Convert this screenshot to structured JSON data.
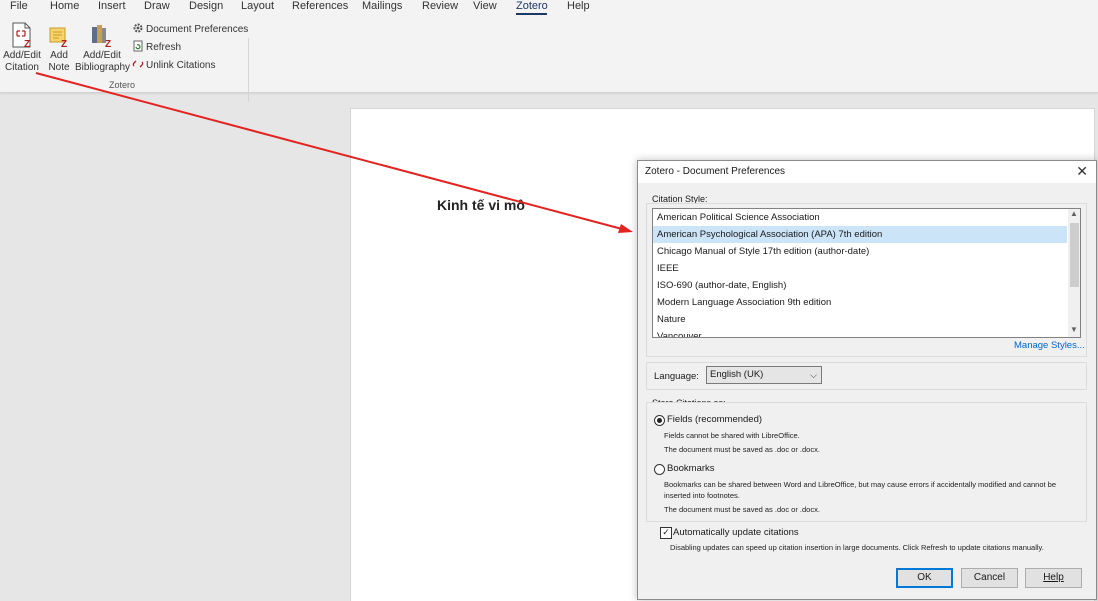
{
  "menubar": {
    "items": [
      "File",
      "Home",
      "Insert",
      "Draw",
      "Design",
      "Layout",
      "References",
      "Mailings",
      "Review",
      "View",
      "Zotero",
      "Help"
    ],
    "active": "Zotero"
  },
  "ribbon": {
    "add_edit_citation": {
      "line1": "Add/Edit",
      "line2": "Citation",
      "icon": "add-citation-icon"
    },
    "add_note": {
      "line1": "Add",
      "line2": "Note",
      "icon": "add-note-icon"
    },
    "add_edit_bibliography": {
      "line1": "Add/Edit",
      "line2": "Bibliography",
      "icon": "bibliography-icon"
    },
    "document_preferences": {
      "label": "Document Preferences",
      "icon": "gear-icon"
    },
    "refresh": {
      "label": "Refresh",
      "icon": "refresh-icon"
    },
    "unlink_citations": {
      "label": "Unlink Citations",
      "icon": "unlink-icon"
    },
    "group_label": "Zotero"
  },
  "document": {
    "heading": "Kinh tế vi mô"
  },
  "annotation": {
    "arrow_color": "#e3231f"
  },
  "dialog": {
    "title": "Zotero - Document Preferences",
    "citation_style_label": "Citation Style:",
    "styles": [
      "American Political Science Association",
      "American Psychological Association (APA) 7th edition",
      "Chicago Manual of Style 17th edition (author-date)",
      "IEEE",
      "ISO-690 (author-date, English)",
      "Modern Language Association 9th edition",
      "Nature",
      "Vancouver"
    ],
    "selected_style": "American Psychological Association (APA) 7th edition",
    "manage_styles": "Manage Styles...",
    "language_label": "Language:",
    "language_value": "English (UK)",
    "store_label": "Store Citations as:",
    "fields_option": "Fields (recommended)",
    "fields_note1": "Fields cannot be shared with LibreOffice.",
    "fields_note2": "The document must be saved as .doc or .docx.",
    "bookmarks_option": "Bookmarks",
    "bookmarks_note1": "Bookmarks can be shared between Word and LibreOffice, but may cause errors if accidentally modified and cannot be",
    "bookmarks_note1b": "inserted into footnotes.",
    "bookmarks_note2": "The document must be saved as .doc or .docx.",
    "store_selected": "fields",
    "auto_update_label": "Automatically update citations",
    "auto_update_checked": true,
    "auto_update_note": "Disabling updates can speed up citation insertion in large documents. Click Refresh to update citations manually.",
    "ok": "OK",
    "cancel": "Cancel",
    "help": "Help",
    "close_icon": "close-icon"
  }
}
